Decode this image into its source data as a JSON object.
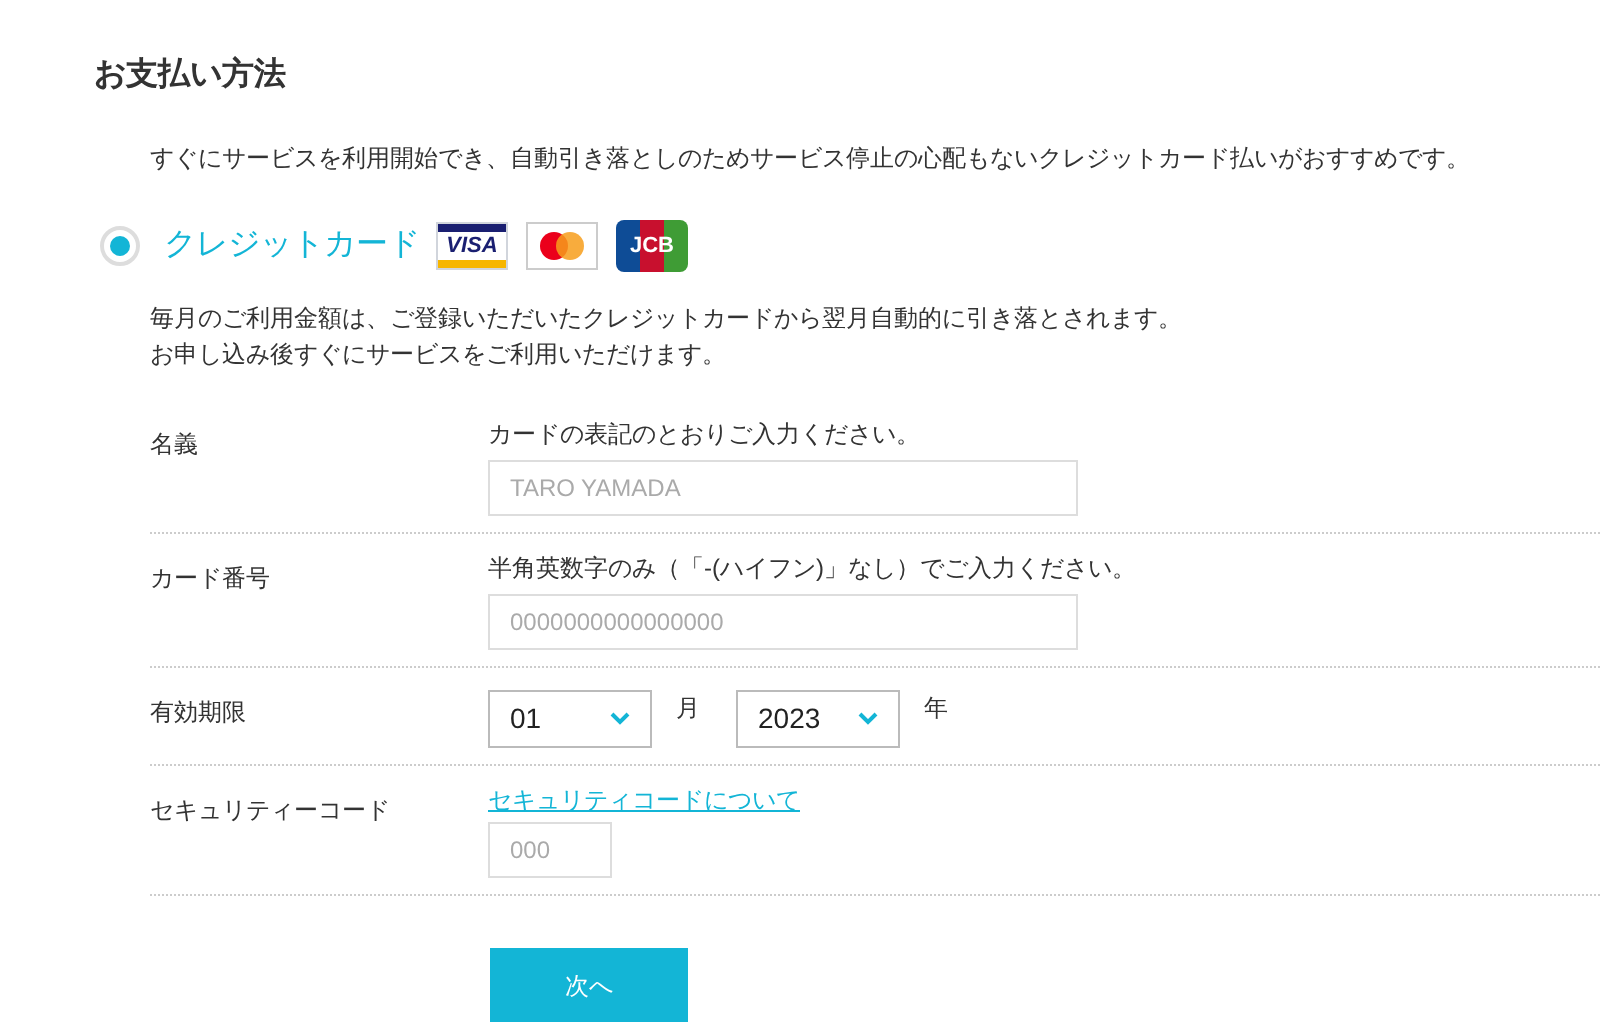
{
  "title": "お支払い方法",
  "intro": "すぐにサービスを利用開始でき、自動引き落としのためサービス停止の心配もないクレジットカード払いがおすすめです。",
  "payment_option": {
    "label": "クレジットカード",
    "selected": true,
    "brands": [
      {
        "kind": "visa",
        "text": "VISA"
      },
      {
        "kind": "mastercard"
      },
      {
        "kind": "jcb",
        "text": "JCB"
      }
    ],
    "notes": [
      "毎月のご利用金額は、ご登録いただいたクレジットカードから翌月自動的に引き落とされます。",
      "お申し込み後すぐにサービスをご利用いただけます。"
    ]
  },
  "fields": [
    {
      "kind": "text",
      "label": "名義",
      "hint": "カードの表記のとおりご入力ください。",
      "placeholder": "TARO YAMADA"
    },
    {
      "kind": "text",
      "label": "カード番号",
      "hint": "半角英数字のみ（「-(ハイフン)」なし）でご入力ください。",
      "placeholder": "0000000000000000"
    },
    {
      "kind": "expiry",
      "label": "有効期限",
      "selects": [
        {
          "value": "01",
          "unit": "月"
        },
        {
          "value": "2023",
          "unit": "年"
        }
      ]
    },
    {
      "kind": "code",
      "label": "セキュリティーコード",
      "link": "セキュリティコードについて",
      "placeholder": "000"
    }
  ],
  "submit": "次へ"
}
